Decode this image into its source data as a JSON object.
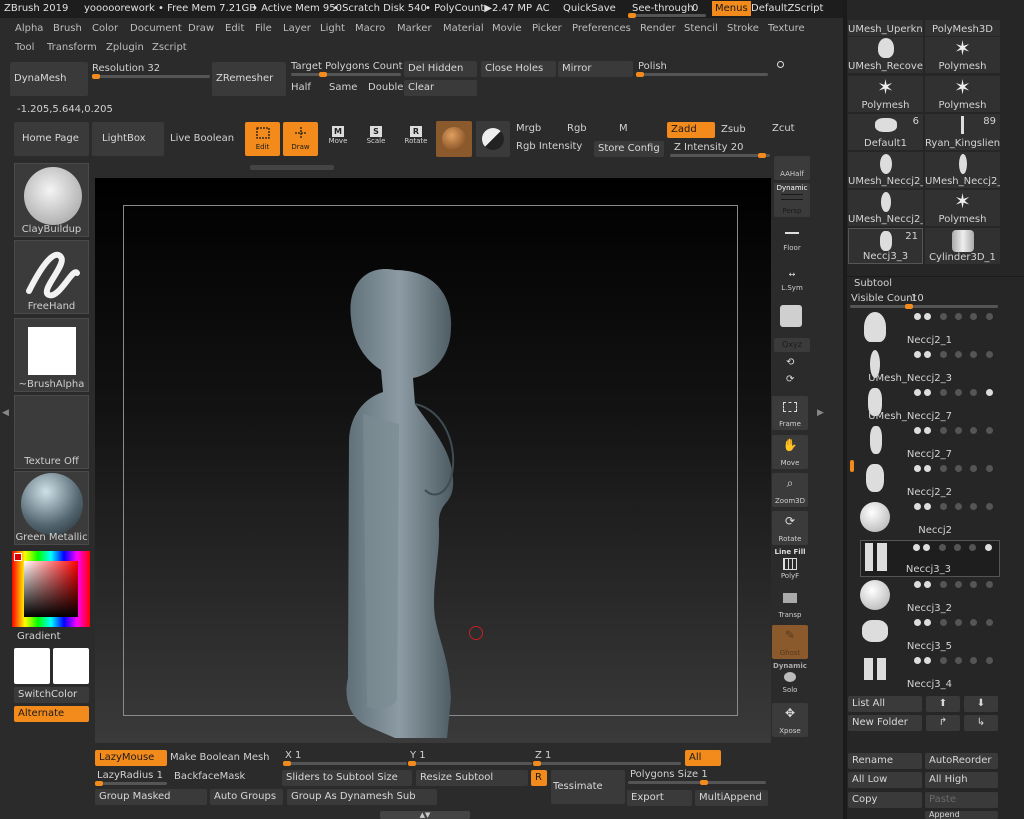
{
  "titlebar": {
    "app": "ZBrush 2019",
    "doc": "yooooorework",
    "free_mem": "• Free Mem 7.21GB",
    "active_mem": "• Active Mem 950",
    "scratch": "• Scratch Disk 540",
    "polycount": "• PolyCount▶2.47 MP",
    "ac": "AC",
    "quicksave": "QuickSave",
    "see_through": "See-through",
    "see_through_value": "0",
    "menus": "Menus",
    "zscript": "DefaultZScript"
  },
  "menus": {
    "row1": [
      "Alpha",
      "Brush",
      "Color",
      "Document",
      "Draw",
      "Edit",
      "File",
      "Layer",
      "Light",
      "Macro",
      "Marker",
      "Material",
      "Movie",
      "Picker",
      "Preferences",
      "Render",
      "Stencil",
      "Stroke",
      "Texture"
    ],
    "row2": [
      "Tool",
      "Transform",
      "Zplugin",
      "Zscript"
    ]
  },
  "shelf": {
    "dynamesh": "DynaMesh",
    "resolution": "Resolution 32",
    "zremesher": "ZRemesher",
    "target_polygons": "Target Polygons Count 5",
    "half": "Half",
    "same": "Same",
    "double": "Double",
    "del_hidden": "Del Hidden",
    "clear": "Clear",
    "close_holes": "Close Holes",
    "mirror": "Mirror",
    "polish": "Polish",
    "coords": "-1.205,5.644,0.205"
  },
  "toolbar": {
    "home_page": "Home Page",
    "lightbox": "LightBox",
    "live_boolean": "Live Boolean",
    "edit": "Edit",
    "draw": "Draw",
    "move": "Move",
    "scale": "Scale",
    "rotate": "Rotate",
    "mrgb": "Mrgb",
    "rgb": "Rgb",
    "m": "M",
    "zadd": "Zadd",
    "zsub": "Zsub",
    "zcut": "Zcut",
    "rgb_intensity": "Rgb Intensity",
    "store_config": "Store Config",
    "z_intensity": "Z Intensity 20"
  },
  "left": {
    "brush": "ClayBuildup",
    "stroke": "FreeHand",
    "alpha": "~BrushAlpha",
    "texture": "Texture Off",
    "material": "Green Metallic",
    "gradient": "Gradient",
    "switch_color": "SwitchColor",
    "alternate": "Alternate"
  },
  "right_tools": {
    "aahalf": "AAHalf",
    "dynamic": "Dynamic",
    "persp": "Persp",
    "floor": "Floor",
    "lsym": "L.Sym",
    "xyz": "Qxyz",
    "frame": "Frame",
    "move": "Move",
    "zoom3d": "Zoom3D",
    "rotate": "Rotate",
    "line_fill": "Line Fill",
    "polyf": "PolyF",
    "transp": "Transp",
    "ghost": "Ghost",
    "dynamic2": "Dynamic",
    "solo": "Solo",
    "xpose": "Xpose"
  },
  "tool_grid": [
    {
      "name": "UMesh_Uperkne",
      "count": ""
    },
    {
      "name": "PolyMesh3D",
      "count": ""
    },
    {
      "name": "UMesh_Recovere",
      "count": ""
    },
    {
      "name": "Polymesh",
      "count": ""
    },
    {
      "name": "Polymesh",
      "count": ""
    },
    {
      "name": "Polymesh",
      "count": ""
    },
    {
      "name": "Default1",
      "count": "6"
    },
    {
      "name": "Ryan_Kingslien_A",
      "count": "89"
    },
    {
      "name": "UMesh_Neccj2_1",
      "count": ""
    },
    {
      "name": "UMesh_Neccj2_2",
      "count": ""
    },
    {
      "name": "UMesh_Neccj2_6",
      "count": ""
    },
    {
      "name": "Polymesh",
      "count": ""
    },
    {
      "name": "Neccj3_3",
      "count": "21"
    },
    {
      "name": "Cylinder3D_1",
      "count": ""
    }
  ],
  "subtool": {
    "title": "Subtool",
    "visible_count": "Visible Count",
    "visible_count_value": "10",
    "items": [
      "Neccj2_1",
      "UMesh_Neccj2_3",
      "UMesh_Neccj2_7",
      "Neccj2_7",
      "Neccj2_2",
      "Neccj2",
      "Neccj3_3",
      "Neccj3_2",
      "Neccj3_5",
      "Neccj3_4"
    ],
    "list_all": "List All",
    "new_folder": "New Folder",
    "rename": "Rename",
    "auto_reorder": "AutoReorder",
    "all_low": "All Low",
    "all_high": "All High",
    "copy": "Copy",
    "paste": "Paste",
    "append": "Append"
  },
  "bottom": {
    "lazymouse": "LazyMouse",
    "make_boolean": "Make Boolean Mesh",
    "x": "X 1",
    "y": "Y 1",
    "z": "Z 1",
    "all": "All",
    "lazyradius": "LazyRadius 1",
    "backface": "BackfaceMask",
    "sliders_subtool": "Sliders to Subtool Size",
    "resize_subtool": "Resize Subtool",
    "r": "R",
    "tessimate": "Tessimate",
    "polygons_size": "Polygons Size 1",
    "group_masked": "Group Masked",
    "auto_groups": "Auto Groups",
    "group_dynamesh": "Group As Dynamesh Sub",
    "export": "Export",
    "multiappend": "MultiAppend"
  },
  "colors": {
    "accent": "#f28a1c",
    "bg": "#2b2b2b",
    "panel": "#3a3a3a"
  }
}
